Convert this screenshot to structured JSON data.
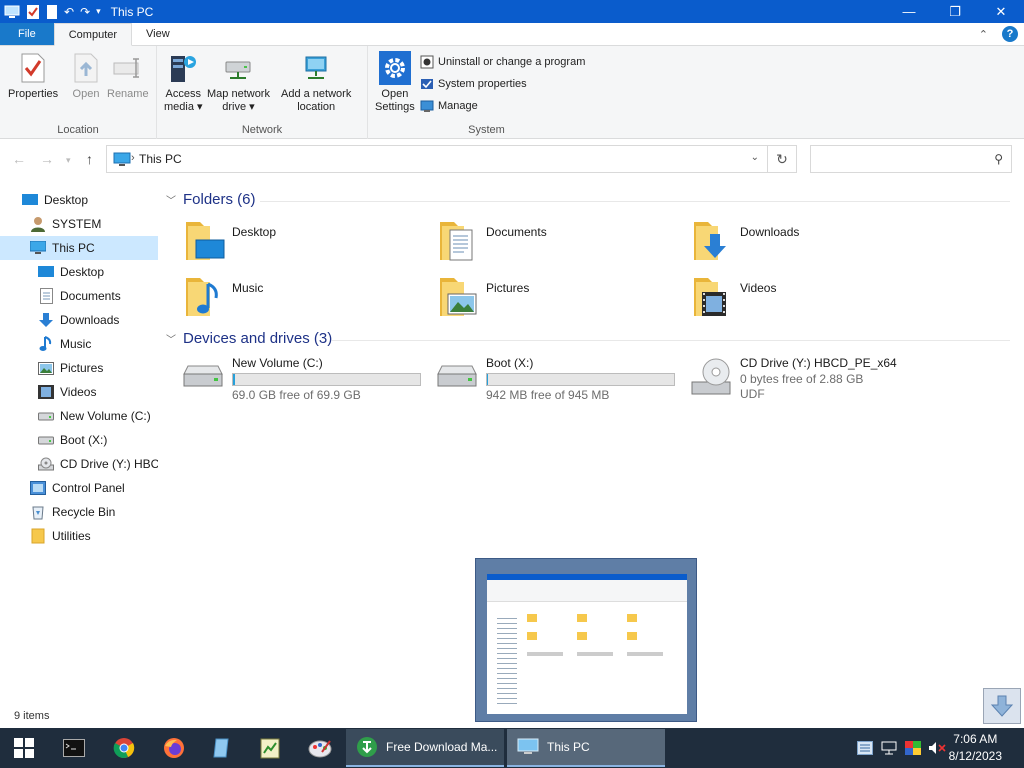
{
  "window": {
    "title": "This PC",
    "minimize_glyph": "—",
    "maximize_glyph": "❐",
    "close_glyph": "✕"
  },
  "ribbon_tabs": {
    "file": "File",
    "computer": "Computer",
    "view": "View"
  },
  "ribbon": {
    "location": {
      "label": "Location",
      "properties": "Properties",
      "open": "Open",
      "rename": "Rename"
    },
    "network": {
      "label": "Network",
      "access_media_line1": "Access",
      "access_media_line2": "media",
      "map_drive_line1": "Map network",
      "map_drive_line2": "drive",
      "add_location_line1": "Add a network",
      "add_location_line2": "location"
    },
    "system": {
      "label": "System",
      "open_settings_line1": "Open",
      "open_settings_line2": "Settings",
      "uninstall": "Uninstall or change a program",
      "system_properties": "System properties",
      "manage": "Manage"
    }
  },
  "address": {
    "crumb": "This PC",
    "search_placeholder": ""
  },
  "nav_pane": {
    "items": [
      {
        "label": "Desktop",
        "icon": "desktop-icon"
      },
      {
        "label": "SYSTEM",
        "icon": "user-icon"
      },
      {
        "label": "This PC",
        "icon": "computer-icon"
      },
      {
        "label": "Desktop",
        "icon": "desktop-icon"
      },
      {
        "label": "Documents",
        "icon": "documents-icon"
      },
      {
        "label": "Downloads",
        "icon": "downloads-icon"
      },
      {
        "label": "Music",
        "icon": "music-icon"
      },
      {
        "label": "Pictures",
        "icon": "pictures-icon"
      },
      {
        "label": "Videos",
        "icon": "videos-icon"
      },
      {
        "label": "New Volume (C:)",
        "icon": "drive-icon"
      },
      {
        "label": "Boot (X:)",
        "icon": "drive-icon"
      },
      {
        "label": "CD Drive (Y:) HBC",
        "icon": "cd-drive-icon"
      },
      {
        "label": "Control Panel",
        "icon": "control-panel-icon"
      },
      {
        "label": "Recycle Bin",
        "icon": "recycle-bin-icon"
      },
      {
        "label": "Utilities",
        "icon": "folder-icon"
      }
    ]
  },
  "content": {
    "folders_header": "Folders (6)",
    "folders": [
      {
        "label": "Desktop",
        "icon": "desktop-folder-icon"
      },
      {
        "label": "Documents",
        "icon": "documents-folder-icon"
      },
      {
        "label": "Downloads",
        "icon": "downloads-folder-icon"
      },
      {
        "label": "Music",
        "icon": "music-folder-icon"
      },
      {
        "label": "Pictures",
        "icon": "pictures-folder-icon"
      },
      {
        "label": "Videos",
        "icon": "videos-folder-icon"
      }
    ],
    "drives_header": "Devices and drives (3)",
    "drives": [
      {
        "name": "New Volume (C:)",
        "free": "69.0 GB free of 69.9 GB",
        "used_fraction": 0.013
      },
      {
        "name": "Boot (X:)",
        "free": "942 MB free of 945 MB",
        "used_fraction": 0.003
      },
      {
        "name": "CD Drive (Y:) HBCD_PE_x64",
        "free": "0 bytes free of 2.88 GB",
        "fs": "UDF"
      }
    ]
  },
  "status": {
    "item_count": "9 items"
  },
  "taskbar": {
    "task1": "Free Download Ma...",
    "task2": "This PC",
    "time": "7:06 AM",
    "date": "8/12/2023"
  },
  "colors": {
    "titlebar": "#0a5ccc",
    "accent": "#1979ca",
    "selection": "#cce8ff",
    "folder": "#f6c84c",
    "taskbar": "#1f2d3d"
  }
}
